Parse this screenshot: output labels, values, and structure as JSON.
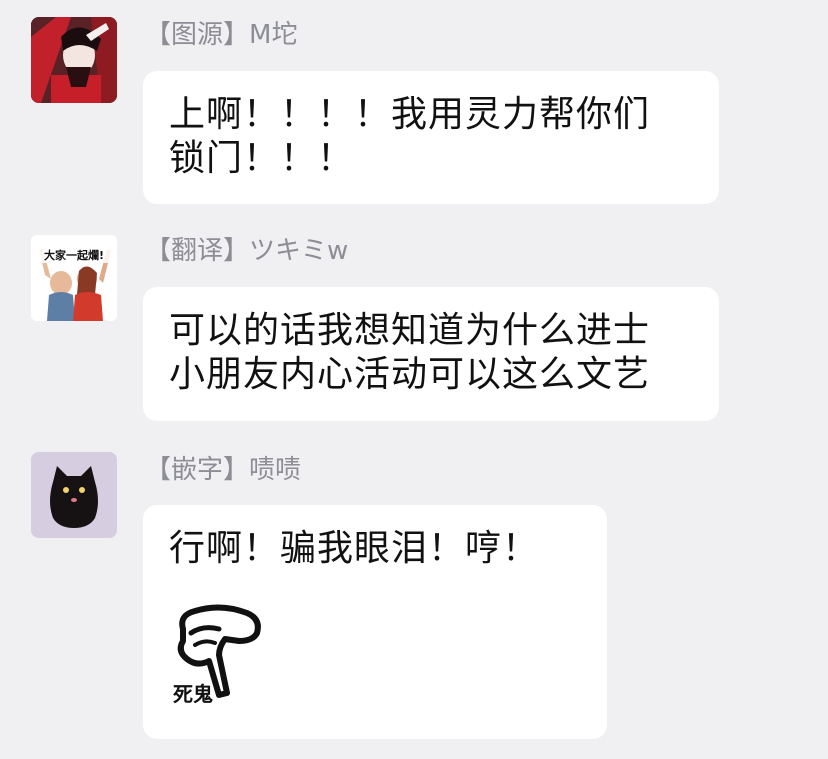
{
  "messages": [
    {
      "tag": "【图源】",
      "name": "M坨",
      "text_lines": [
        "上啊！！！！我用灵力帮你们",
        "锁门！！！"
      ]
    },
    {
      "tag": "【翻译】",
      "name": "ツキミw",
      "avatar_caption": "大家一起爛!",
      "text_lines": [
        "可以的话我想知道为什么进士",
        "小朋友内心活动可以这么文艺"
      ]
    },
    {
      "tag": "【嵌字】",
      "name": "啧啧",
      "text_lines": [
        "行啊！骗我眼泪！哼！"
      ],
      "sticker_caption": "死鬼"
    }
  ],
  "colors": {
    "background": "#f0f0f3",
    "bubble": "#ffffff",
    "sender": "#8d8d96",
    "text": "#111111",
    "cat_avatar_bg": "#d6cde0"
  },
  "icons": [
    "anime-avatar-icon",
    "meme-avatar-icon",
    "black-cat-avatar-icon",
    "pointing-hand-sticker-icon"
  ]
}
